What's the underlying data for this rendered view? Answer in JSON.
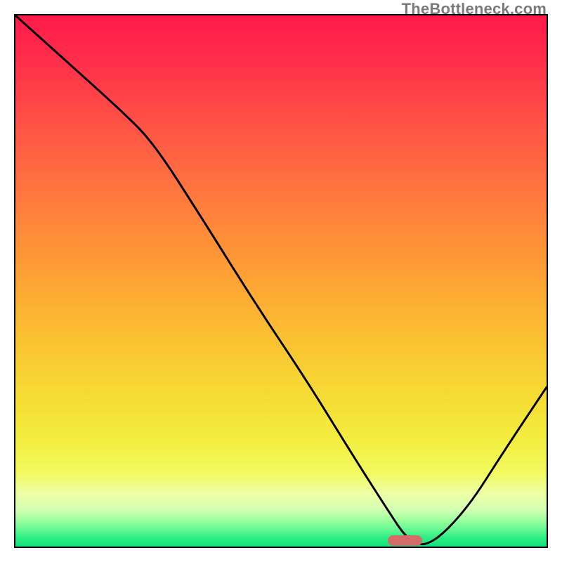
{
  "watermark": {
    "text": "TheBottleneck.com"
  },
  "chart_data": {
    "type": "line",
    "title": "",
    "xlabel": "",
    "ylabel": "",
    "xlim": [
      0,
      100
    ],
    "ylim": [
      0,
      100
    ],
    "grid": false,
    "legend": false,
    "series": [
      {
        "name": "bottleneck-curve",
        "x": [
          0,
          10,
          20,
          26,
          35,
          45,
          55,
          63,
          70,
          74,
          78,
          85,
          92,
          100
        ],
        "values": [
          100,
          91,
          82,
          76,
          62,
          46,
          31,
          18,
          7,
          1,
          0,
          7,
          18,
          30
        ]
      }
    ],
    "marker": {
      "position_x_pct": 73,
      "position_y_pct": 1,
      "width_pct": 6.5,
      "color": "#d46a6a"
    },
    "background_gradient": {
      "stops": [
        {
          "pct": 0,
          "color": "#ff1a49"
        },
        {
          "pct": 50,
          "color": "#fe9e35"
        },
        {
          "pct": 80,
          "color": "#f3ee40"
        },
        {
          "pct": 100,
          "color": "#10e27c"
        }
      ]
    }
  }
}
